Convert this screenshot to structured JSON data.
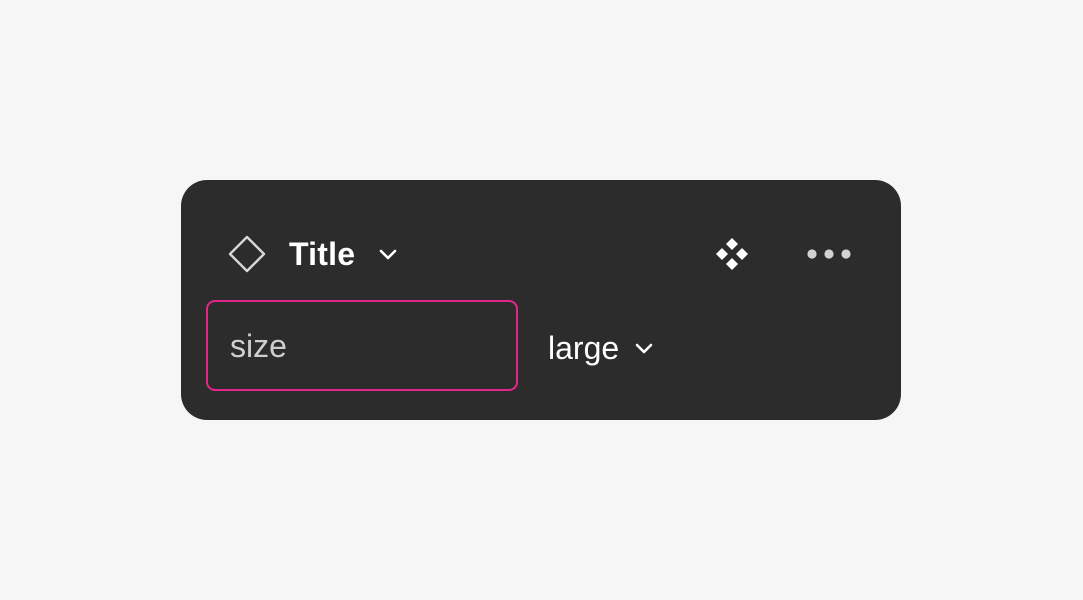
{
  "panel": {
    "header": {
      "component_icon": "component-diamond-outline-icon",
      "title": "Title",
      "title_dropdown_icon": "chevron-down-icon",
      "instance_icon": "instance-diamonds-icon",
      "more_icon": "more-horizontal-icon"
    },
    "property": {
      "name": "size",
      "value": "large",
      "value_dropdown_icon": "chevron-down-icon"
    }
  },
  "colors": {
    "page_background": "#f6f6f6",
    "panel_background": "#2c2c2c",
    "focus_outline": "#e4268a",
    "primary_text": "#ffffff",
    "secondary_text": "#cfcfcf"
  }
}
